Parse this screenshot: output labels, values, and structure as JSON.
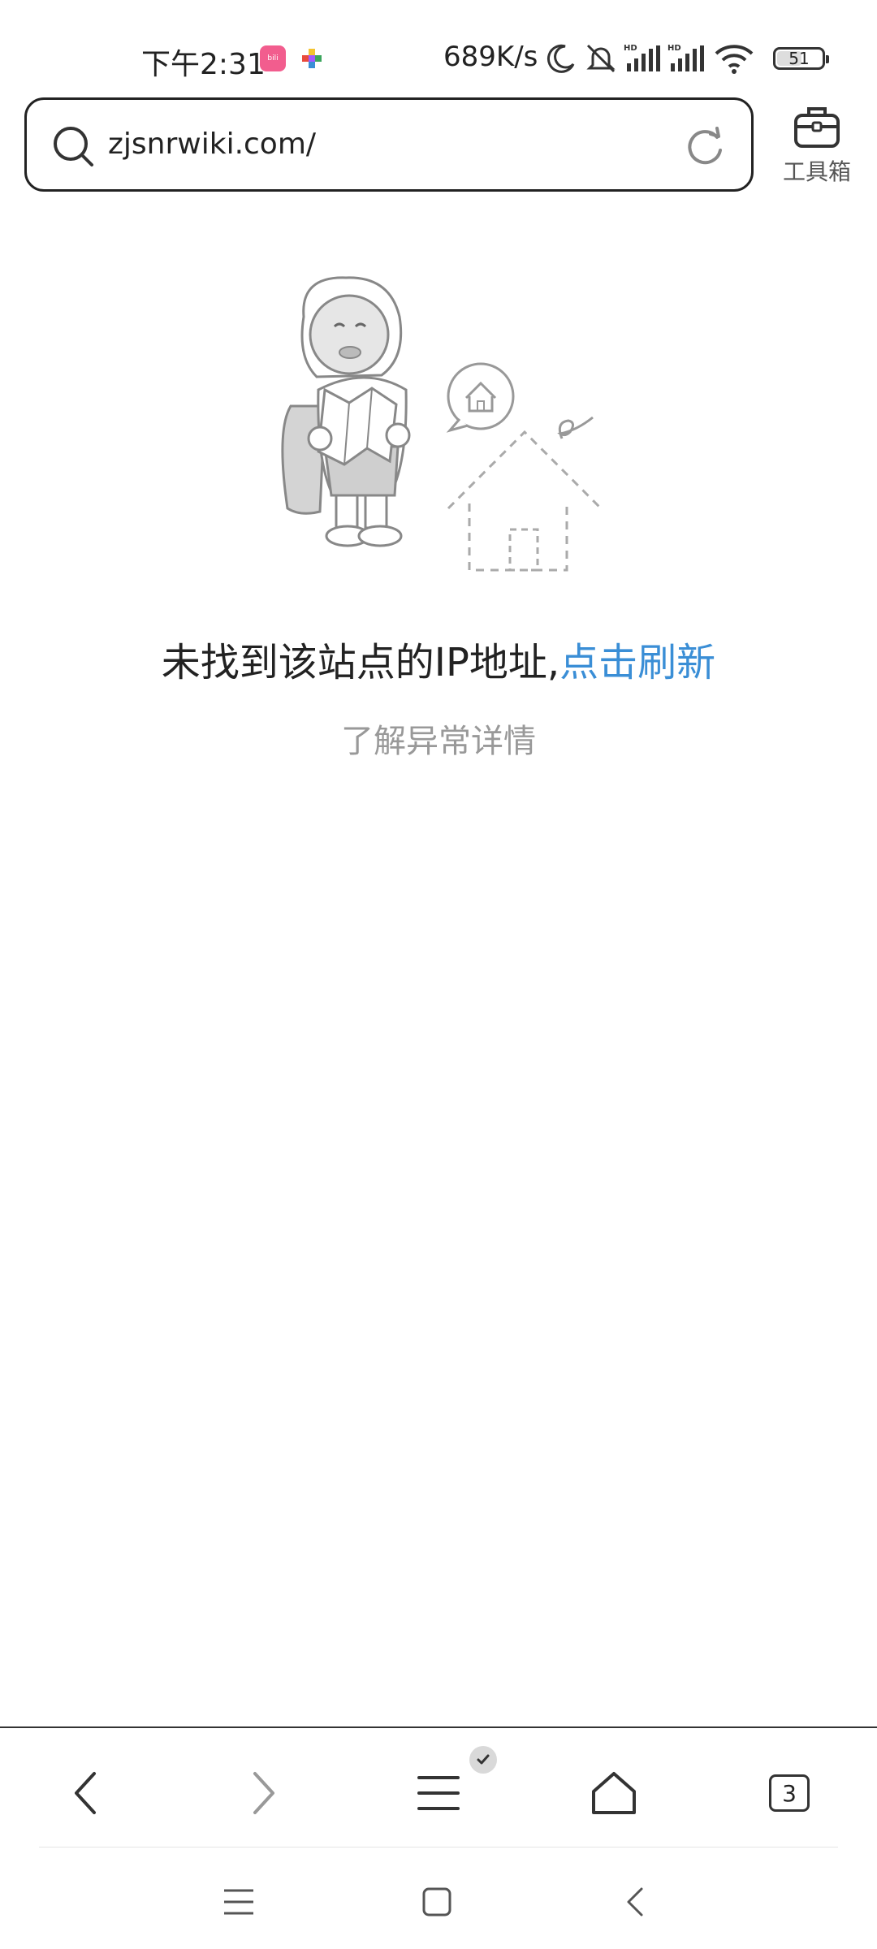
{
  "status_bar": {
    "time": "下午2:31",
    "network_speed": "689K/s",
    "battery_level": "51",
    "icons": [
      "bilibili-app-icon",
      "multicolor-app-icon",
      "moon-icon",
      "mute-icon",
      "hd-signal-icon",
      "hd-signal-icon",
      "wifi-icon",
      "battery-icon"
    ]
  },
  "address_bar": {
    "url": "zjsnrwiki.com/",
    "search_icon": "search-icon",
    "refresh_icon": "refresh-icon"
  },
  "toolbox": {
    "label": "工具箱",
    "icon": "briefcase-icon"
  },
  "error": {
    "message": "未找到该站点的IP地址,",
    "refresh_link": "点击刷新",
    "details_link": "了解异常详情"
  },
  "bottom_toolbar": {
    "tab_count": "3",
    "icons": [
      "back-icon",
      "forward-icon",
      "menu-icon",
      "home-icon",
      "tabs-icon"
    ]
  },
  "colors": {
    "link": "#3a8ed6",
    "muted": "#999999",
    "text": "#222222"
  }
}
